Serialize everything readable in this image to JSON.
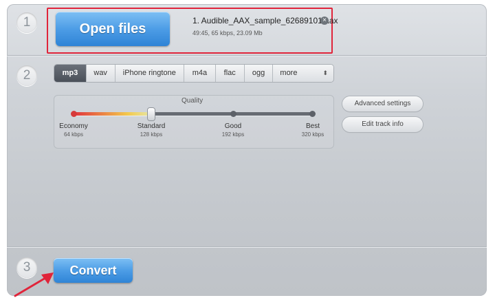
{
  "steps": {
    "one": "1",
    "two": "2",
    "three": "3"
  },
  "open_files": {
    "label": "Open files"
  },
  "file": {
    "name": "1. Audible_AAX_sample_62689101.aax",
    "meta": "49:45, 65 kbps, 23.09 Mb",
    "remove_icon": "close-icon"
  },
  "formats": {
    "items": [
      "mp3",
      "wav",
      "iPhone ringtone",
      "m4a",
      "flac",
      "ogg",
      "more"
    ],
    "selected": "mp3",
    "more_icon": "updown-chevron-icon"
  },
  "quality": {
    "label": "Quality",
    "levels": [
      {
        "name": "Economy",
        "bitrate": "64 kbps"
      },
      {
        "name": "Standard",
        "bitrate": "128 kbps"
      },
      {
        "name": "Good",
        "bitrate": "192 kbps"
      },
      {
        "name": "Best",
        "bitrate": "320 kbps"
      }
    ],
    "selected_index": 1
  },
  "buttons": {
    "advanced_settings": "Advanced settings",
    "edit_track_info": "Edit track info"
  },
  "convert": {
    "label": "Convert"
  },
  "colors": {
    "highlight": "#e0243a",
    "arrow": "#e0243a",
    "accent": "#4d9de6"
  }
}
